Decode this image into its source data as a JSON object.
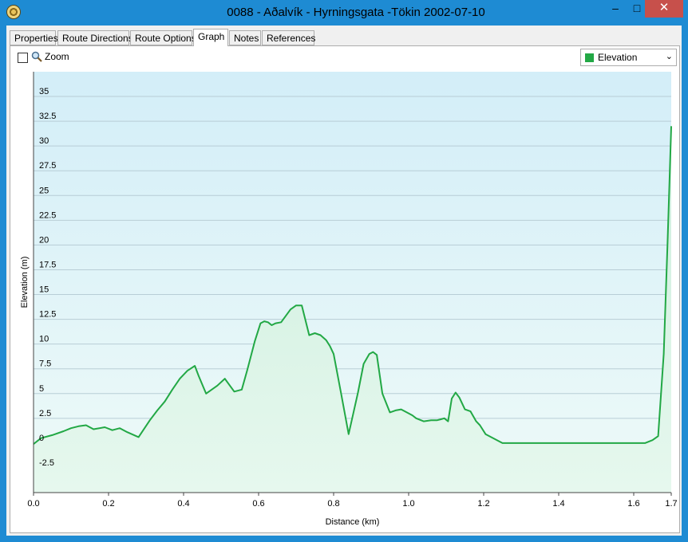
{
  "window": {
    "title": "0088 - Aðalvík - Hyrningsgata -Tökin 2002-07-10",
    "minimize_glyph": "–",
    "maximize_glyph": "□",
    "close_glyph": "✕"
  },
  "tabs": [
    {
      "label": "Properties"
    },
    {
      "label": "Route Directions"
    },
    {
      "label": "Route Options"
    },
    {
      "label": "Graph",
      "active": true
    },
    {
      "label": "Notes"
    },
    {
      "label": "References"
    }
  ],
  "toolbar": {
    "zoom_label": "Zoom",
    "zoom_checked": false,
    "series_select": "Elevation",
    "series_color": "#22a845"
  },
  "chart_data": {
    "type": "area",
    "xlabel": "Distance  (km)",
    "ylabel": "Elevation (m)",
    "xlim": [
      0,
      1.7
    ],
    "ylim": [
      -5,
      37.5
    ],
    "x_ticks": [
      "0.0",
      "0.2",
      "0.4",
      "0.6",
      "0.8",
      "1.0",
      "1.2",
      "1.4",
      "1.6",
      "1.7"
    ],
    "x_tick_values": [
      0,
      0.2,
      0.4,
      0.6,
      0.8,
      1.0,
      1.2,
      1.4,
      1.6,
      1.7
    ],
    "y_ticks": [
      "35",
      "32.5",
      "30",
      "27.5",
      "25",
      "22.5",
      "20",
      "17.5",
      "15",
      "12.5",
      "10",
      "7.5",
      "5",
      "2.5",
      "0",
      "-2.5"
    ],
    "y_tick_values": [
      35,
      32.5,
      30,
      27.5,
      25,
      22.5,
      20,
      17.5,
      15,
      12.5,
      10,
      7.5,
      5,
      2.5,
      0,
      -2.5
    ],
    "grid": true,
    "background": "light blue gradient",
    "series": [
      {
        "color": "#22a845",
        "x": [
          0,
          0.02,
          0.05,
          0.08,
          0.1,
          0.12,
          0.14,
          0.16,
          0.19,
          0.21,
          0.23,
          0.25,
          0.28,
          0.31,
          0.33,
          0.35,
          0.37,
          0.39,
          0.41,
          0.43,
          0.44,
          0.46,
          0.49,
          0.51,
          0.535,
          0.555,
          0.57,
          0.59,
          0.605,
          0.615,
          0.625,
          0.635,
          0.645,
          0.66,
          0.685,
          0.7,
          0.715,
          0.735,
          0.75,
          0.765,
          0.78,
          0.79,
          0.8,
          0.81,
          0.82,
          0.84,
          0.865,
          0.88,
          0.895,
          0.905,
          0.915,
          0.93,
          0.95,
          0.965,
          0.98,
          0.995,
          1.01,
          1.02,
          1.04,
          1.06,
          1.075,
          1.085,
          1.095,
          1.105,
          1.115,
          1.125,
          1.135,
          1.15,
          1.165,
          1.18,
          1.19,
          1.205,
          1.25,
          1.3,
          1.4,
          1.5,
          1.6,
          1.63,
          1.65,
          1.665,
          1.68,
          1.69,
          1.7
        ],
        "values": [
          -0.1,
          0.5,
          0.8,
          1.2,
          1.5,
          1.7,
          1.8,
          1.4,
          1.6,
          1.3,
          1.5,
          1.1,
          0.6,
          2.3,
          3.3,
          4.2,
          5.4,
          6.5,
          7.3,
          7.8,
          6.8,
          5.0,
          5.8,
          6.5,
          5.2,
          5.4,
          7.4,
          10.3,
          12.1,
          12.3,
          12.2,
          11.9,
          12.1,
          12.2,
          13.5,
          13.9,
          13.9,
          10.9,
          11.1,
          10.9,
          10.4,
          9.8,
          9.0,
          7.0,
          5.0,
          0.9,
          5.1,
          8.0,
          9.0,
          9.2,
          8.9,
          5.0,
          3.1,
          3.3,
          3.4,
          3.1,
          2.8,
          2.5,
          2.2,
          2.3,
          2.3,
          2.4,
          2.5,
          2.2,
          4.5,
          5.1,
          4.6,
          3.4,
          3.2,
          2.2,
          1.8,
          0.9,
          0.0,
          0.0,
          0.0,
          0.0,
          0.0,
          0.0,
          0.3,
          0.7,
          9.0,
          20.0,
          32.0
        ]
      }
    ]
  }
}
